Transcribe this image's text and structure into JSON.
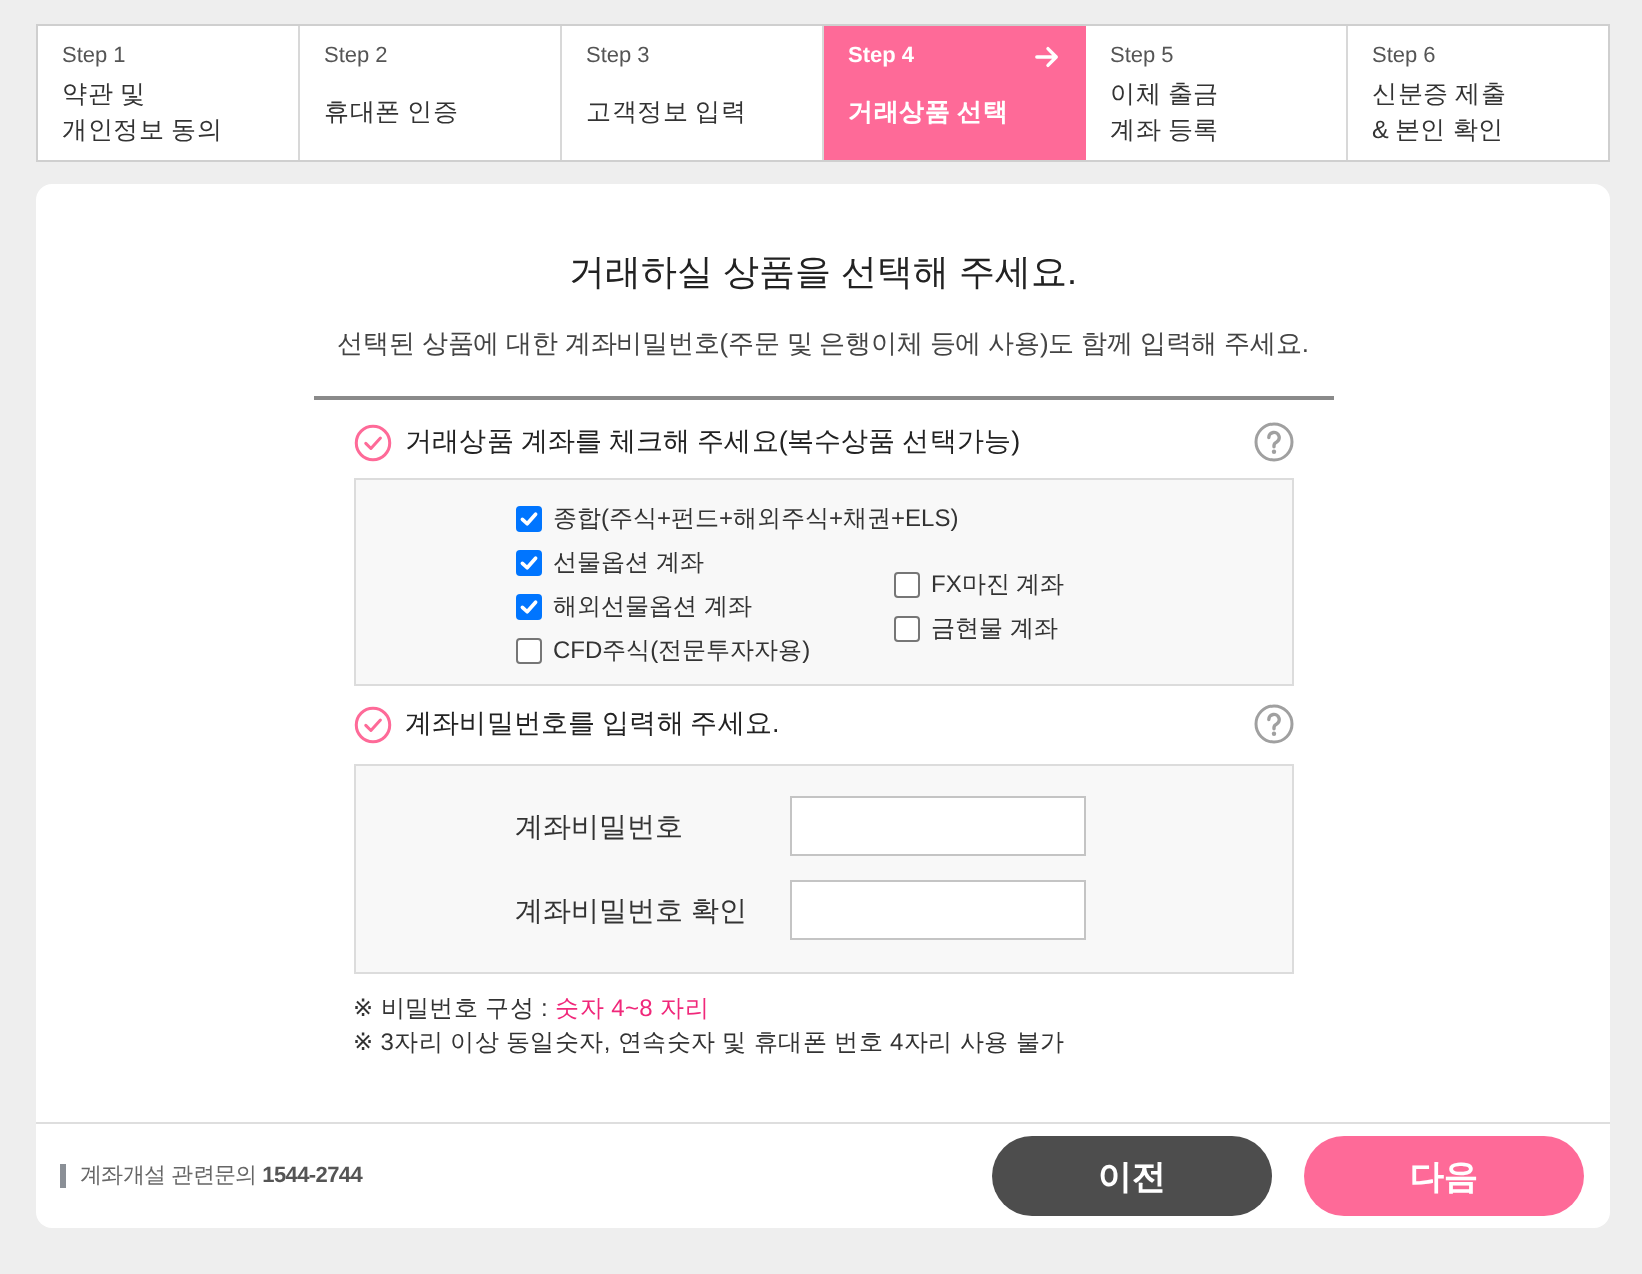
{
  "steps": [
    {
      "step": "Step 1",
      "title": "약관 및\n개인정보 동의",
      "selected": false
    },
    {
      "step": "Step 2",
      "title": "휴대폰 인증",
      "selected": false
    },
    {
      "step": "Step 3",
      "title": "고객정보 입력",
      "selected": false
    },
    {
      "step": "Step 4",
      "title": "거래상품 선택",
      "selected": true
    },
    {
      "step": "Step 5",
      "title": "이체 출금\n계좌 등록",
      "selected": false
    },
    {
      "step": "Step 6",
      "title": "신분증 제출\n& 본인 확인",
      "selected": false
    }
  ],
  "heading": {
    "title": "거래하실 상품을 선택해 주세요.",
    "subtitle": "선택된 상품에 대한 계좌비밀번호(주문 및 은행이체 등에 사용)도 함께 입력해 주세요."
  },
  "product_section": {
    "title": "거래상품 계좌를 체크해 주세요(복수상품 선택가능)",
    "wide_options": [
      {
        "label": "종합(주식+펀드+해외주식+채권+ELS)",
        "checked": true
      }
    ],
    "option_columns": [
      [
        {
          "label": "선물옵션 계좌",
          "checked": true
        },
        {
          "label": "해외선물옵션 계좌",
          "checked": true
        },
        {
          "label": "CFD주식(전문투자자용)",
          "checked": false
        }
      ],
      [
        {
          "label": "FX마진 계좌",
          "checked": false
        },
        {
          "label": "금현물 계좌",
          "checked": false
        }
      ]
    ]
  },
  "password_section": {
    "title": "계좌비밀번호를 입력해 주세요.",
    "fields": [
      {
        "label": "계좌비밀번호"
      },
      {
        "label": "계좌비밀번호 확인"
      }
    ]
  },
  "notes": [
    {
      "text": "※ 비밀번호 구성 :",
      "highlight": "숫자 4~8 자리"
    },
    {
      "text": "※ 3자리 이상 동일숫자, 연속숫자 및 휴대폰 번호 4자리 사용 불가"
    }
  ],
  "footer": {
    "contact": "계좌개설 관련문의 **1544-2744**",
    "buttons": [
      {
        "label": "이전",
        "kind": "secondary"
      },
      {
        "label": "다음",
        "kind": "primary"
      }
    ]
  }
}
